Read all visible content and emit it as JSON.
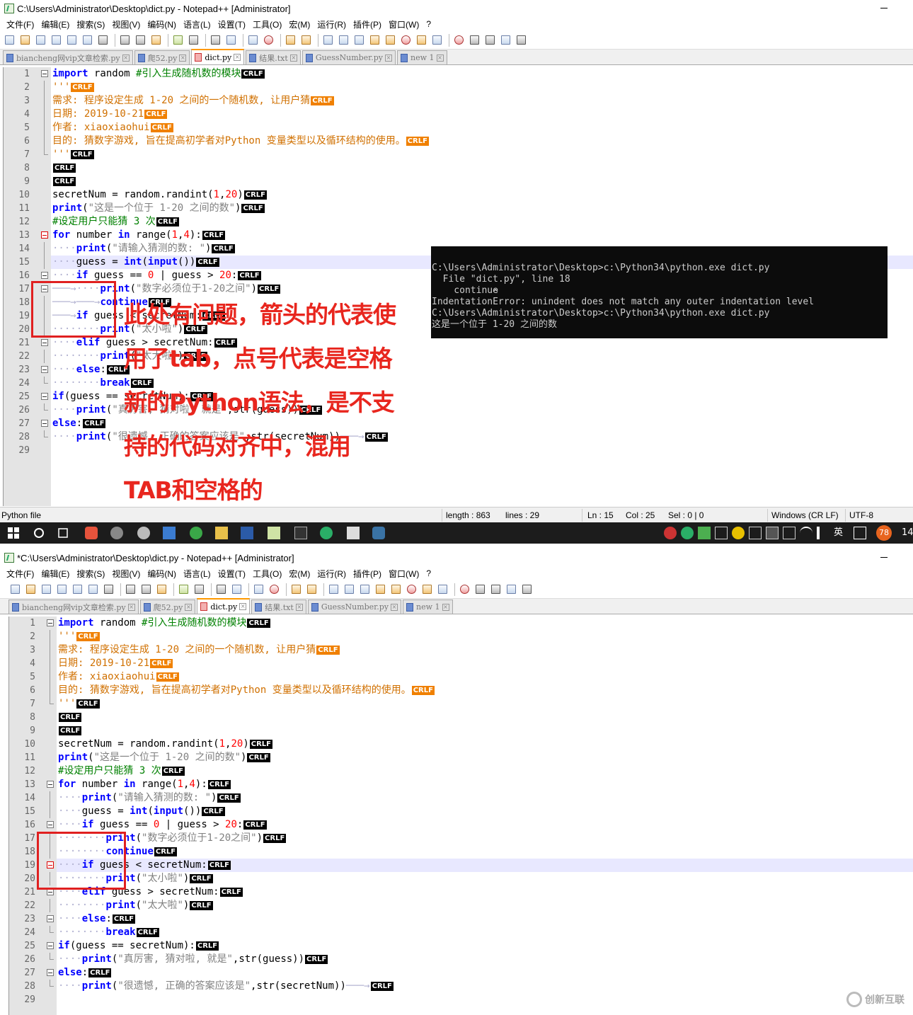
{
  "window1": {
    "title": "C:\\Users\\Administrator\\Desktop\\dict.py - Notepad++ [Administrator]",
    "tabs": [
      "biancheng网vip文章检索.py",
      "爬52.py",
      "dict.py",
      "结果.txt",
      "GuessNumber.py",
      "new 1"
    ]
  },
  "window2": {
    "title": "*C:\\Users\\Administrator\\Desktop\\dict.py - Notepad++ [Administrator]",
    "tabs": [
      "biancheng网vip文章检索.py",
      "爬52.py",
      "dict.py",
      "结果.txt",
      "GuessNumber.py",
      "new 1"
    ]
  },
  "menu": [
    "文件(F)",
    "编辑(E)",
    "搜索(S)",
    "视图(V)",
    "编码(N)",
    "语言(L)",
    "设置(T)",
    "工具(O)",
    "宏(M)",
    "运行(R)",
    "插件(P)",
    "窗口(W)",
    "?"
  ],
  "eol_marker": "CRLF",
  "code_lines": [
    {
      "n": 1,
      "kw1": "import",
      "t1": " random ",
      "cm": "#引入生成随机数的模块"
    },
    {
      "n": 2,
      "t": "'''"
    },
    {
      "n": 3,
      "t": "需求: 程序设定生成 1-20 之间的一个随机数, 让用户猜"
    },
    {
      "n": 4,
      "t": "日期: 2019-10-21"
    },
    {
      "n": 5,
      "t": "作者: xiaoxiaohui"
    },
    {
      "n": 6,
      "t": "目的: 猜数字游戏, 旨在提高初学者对Python 变量类型以及循环结构的使用。"
    },
    {
      "n": 7,
      "t": "'''"
    },
    {
      "n": 8,
      "t": ""
    },
    {
      "n": 9,
      "t": ""
    },
    {
      "n": 10,
      "t1": "secretNum = random.randint(",
      "n1": "1",
      "t2": ",",
      "n2": "20",
      "t3": ")"
    },
    {
      "n": 11,
      "kw1": "print",
      "t1": "(",
      "s": "\"这是一个位于 1-20 之间的数\"",
      "t2": ")"
    },
    {
      "n": 12,
      "t": "#设定用户只能猜 3 次"
    },
    {
      "n": 13,
      "kw1": "for",
      "t1": " number ",
      "kw2": "in",
      "t2": " range(",
      "n1": "1",
      "t3": ",",
      "n2": "4",
      "t4": "):"
    },
    {
      "n": 14,
      "kw1": "print",
      "t1": "(",
      "s": "\"请输入猜测的数: \"",
      "t2": ")"
    },
    {
      "n": 15,
      "t1": "guess = ",
      "kw1": "int",
      "t2": "(",
      "kw2": "input",
      "t3": "())"
    },
    {
      "n": 16,
      "kw1": "if",
      "t1": " guess == ",
      "n1": "0",
      "t2": " | guess > ",
      "n2": "20",
      "t3": ":"
    },
    {
      "n": 17,
      "kw1": "print",
      "t1": "(",
      "s": "\"数字必须位于1-20之间\"",
      "t2": ")"
    },
    {
      "n": 18,
      "kw1": "continue"
    },
    {
      "n": 19,
      "kw1": "if",
      "t1": " guess < secretNum:"
    },
    {
      "n": 20,
      "kw1": "print",
      "t1": "(",
      "s": "\"太小啦\"",
      "t2": ")"
    },
    {
      "n": 21,
      "kw1": "elif",
      "t1": " guess > secretNum:"
    },
    {
      "n": 22,
      "kw1": "print",
      "t1": "(",
      "s": "\"太大啦\"",
      "t2": ")"
    },
    {
      "n": 23,
      "kw1": "else",
      "t1": ":"
    },
    {
      "n": 24,
      "kw1": "break"
    },
    {
      "n": 25,
      "kw1": "if",
      "t1": "(guess == secretNum):"
    },
    {
      "n": 26,
      "kw1": "print",
      "t1": "(",
      "s": "\"真厉害, 猜对啦, 就是\"",
      "t2": ",str(guess))"
    },
    {
      "n": 27,
      "kw1": "else",
      "t1": ":"
    },
    {
      "n": 28,
      "kw1": "print",
      "t1": "(",
      "s": "\"很遗憾, 正确的答案应该是\"",
      "t2": ",str(secretNum))"
    },
    {
      "n": 29,
      "t": ""
    }
  ],
  "statusbar": {
    "filetype": "Python file",
    "length": "length : 863",
    "lines": "lines : 29",
    "ln": "Ln : 15",
    "col": "Col : 25",
    "sel": "Sel : 0 | 0",
    "eol": "Windows (CR LF)",
    "encoding": "UTF-8"
  },
  "taskbar": {
    "badge": "78",
    "ime": "英",
    "clock": "14"
  },
  "console": {
    "lines": [
      "C:\\Users\\Administrator\\Desktop>c:\\Python34\\python.exe dict.py",
      "  File \"dict.py\", line 18",
      "    continue",
      "           ^",
      "IndentationError: unindent does not match any outer indentation level",
      "",
      "C:\\Users\\Administrator\\Desktop>c:\\Python34\\python.exe dict.py",
      "这是一个位于 1-20 之间的数"
    ]
  },
  "annotation": {
    "lines": [
      "此处有问题，箭头的代表使",
      "用了tab，点号代表是空格",
      "新的Python语法，是不支",
      "持的代码对齐中，混用",
      "TAB和空格的"
    ],
    "color": "#e8261e"
  },
  "watermark": {
    "text": "创新互联"
  }
}
